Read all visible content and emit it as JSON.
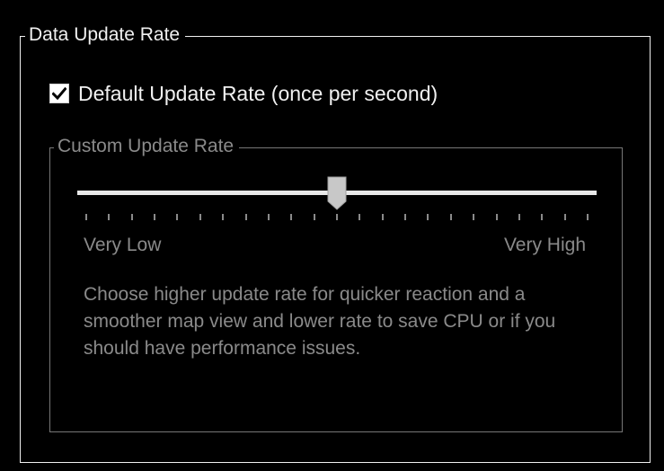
{
  "data_update_rate": {
    "title": "Data Update Rate",
    "default_checkbox": {
      "label": "Default Update Rate (once per second)",
      "checked": true,
      "icon": "checkmark-icon"
    },
    "custom": {
      "title": "Custom Update Rate",
      "enabled": false,
      "slider": {
        "value_fraction": 0.5,
        "tick_count": 23,
        "min_label": "Very Low",
        "max_label": "Very High"
      },
      "description": "Choose higher update rate for quicker reaction and a smoother map view and lower rate to save CPU or if you should have performance issues."
    }
  },
  "colors": {
    "background": "#000000",
    "text": "#f0f0f0",
    "disabled_text": "#8a8a8a",
    "track": "#e8e8e8",
    "thumb": "#c8c8c8"
  }
}
